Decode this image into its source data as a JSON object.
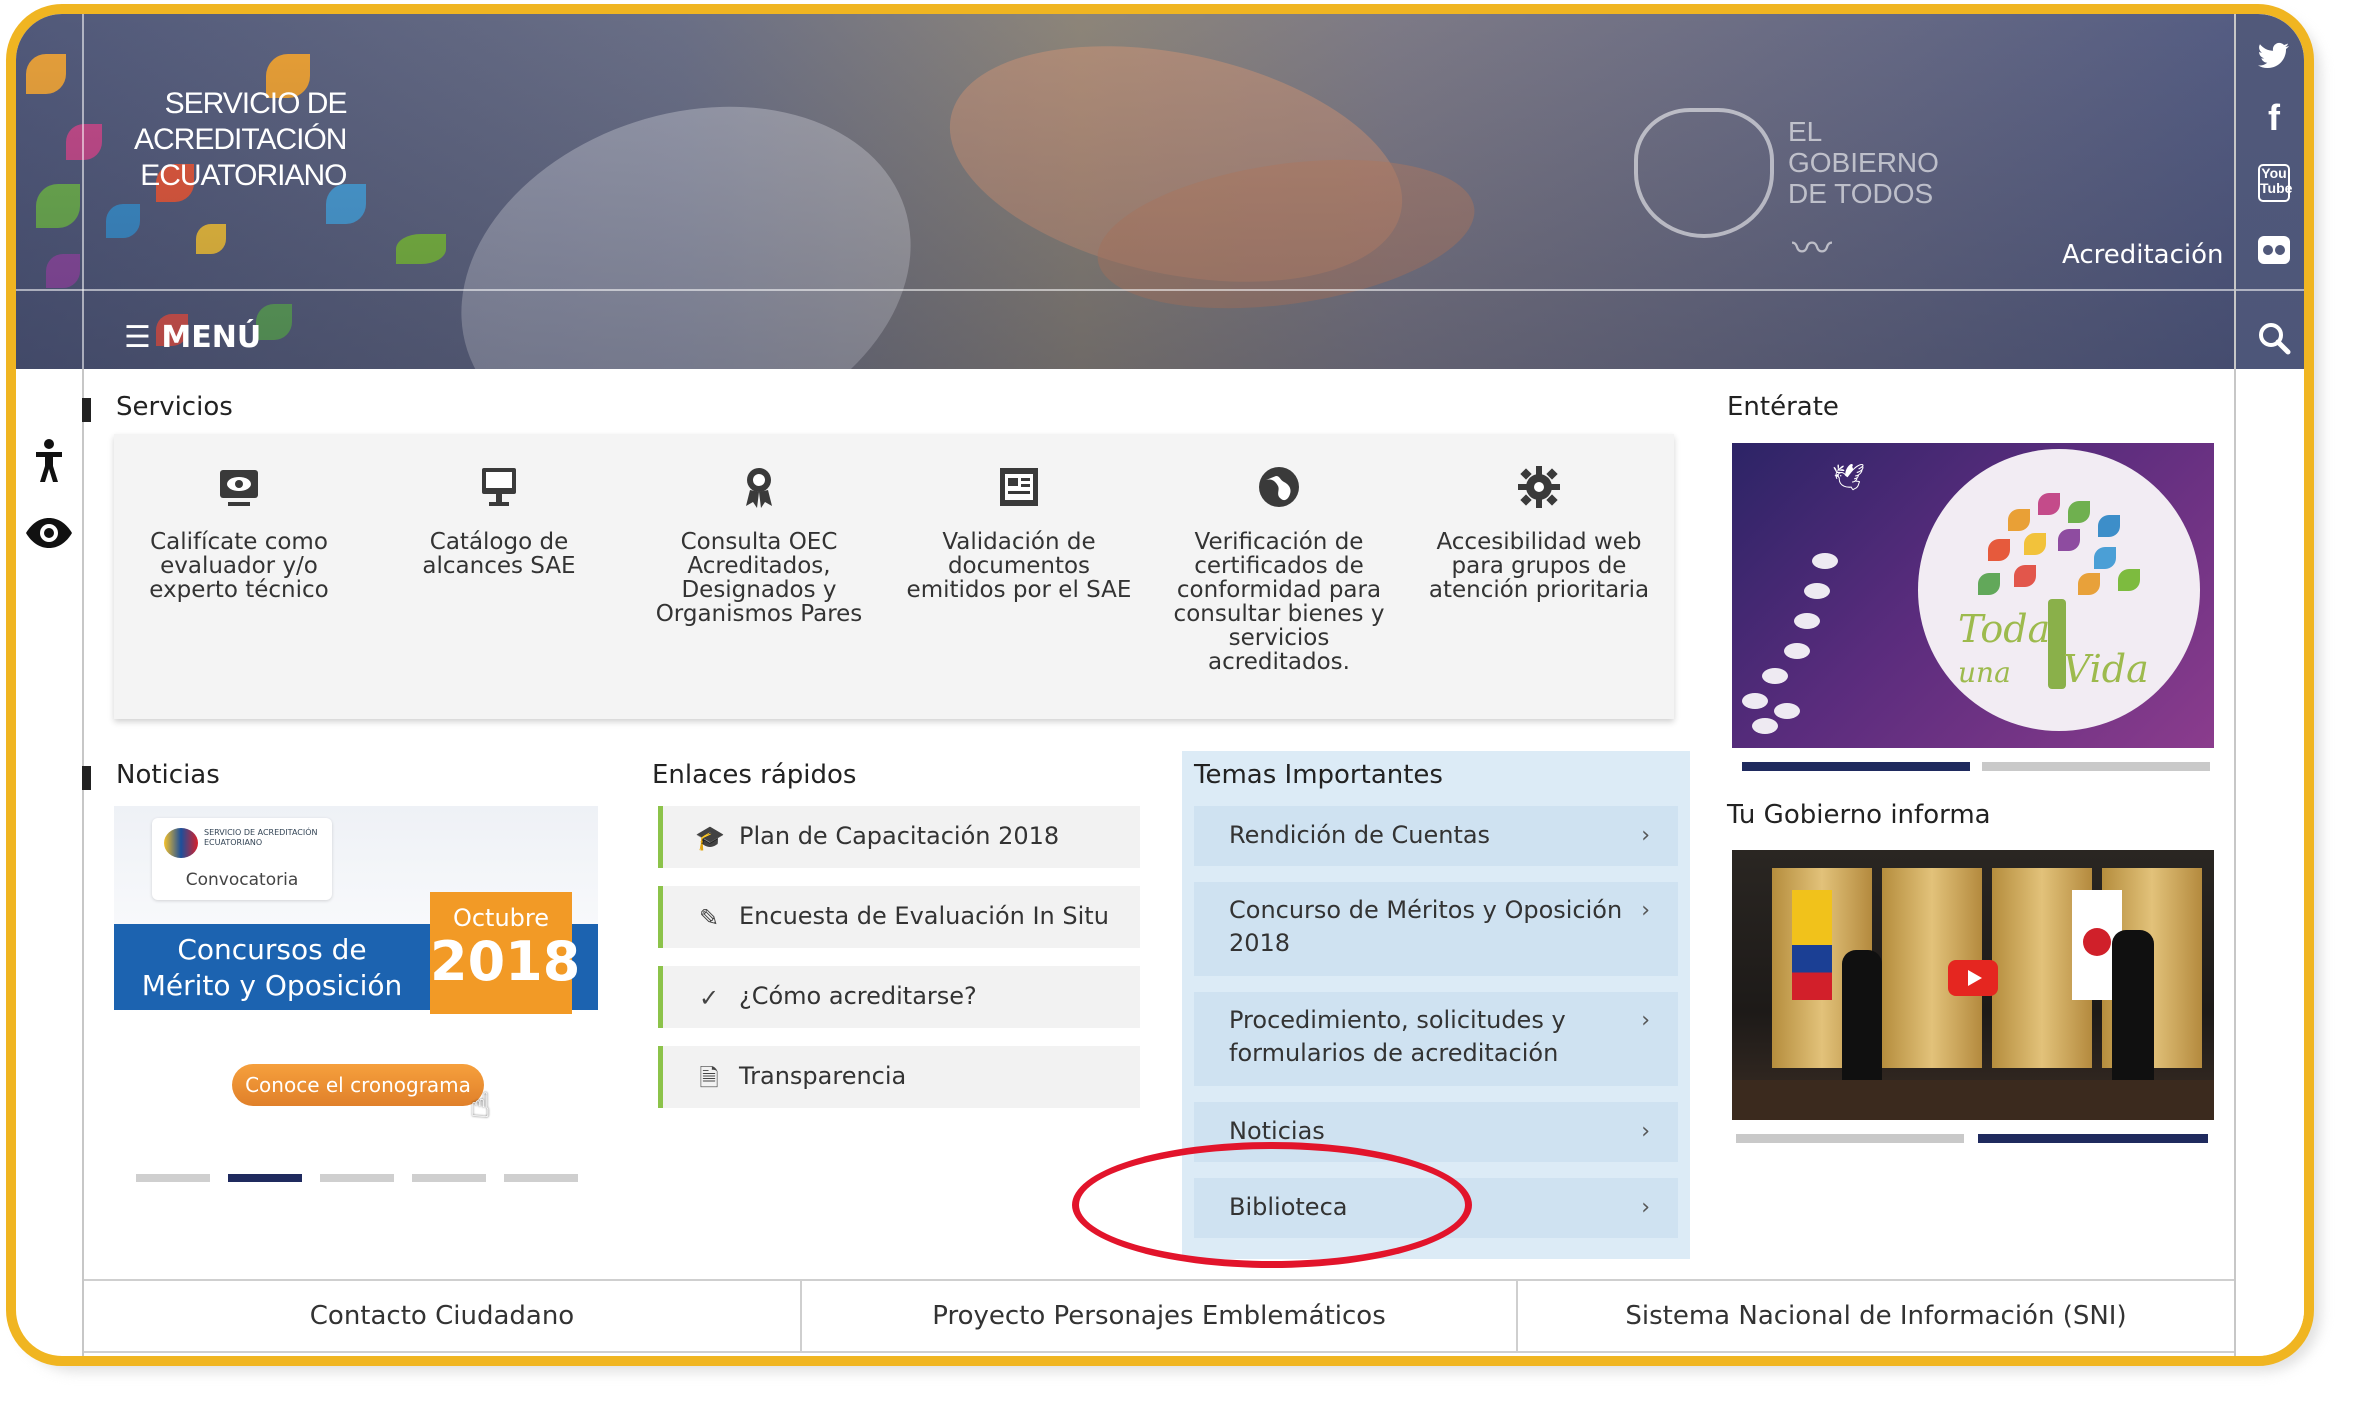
{
  "header": {
    "logo_lines": [
      "SERVICIO DE",
      "ACREDITACIÓN",
      "ECUATORIANO"
    ],
    "gobierno_lines": [
      "EL",
      "GOBIERNO",
      "DE TODOS"
    ],
    "section_label": "Acreditación",
    "menu_label": "MENÚ"
  },
  "social": {
    "icons": [
      "twitter-icon",
      "facebook-icon",
      "youtube-icon",
      "flickr-icon",
      "search-icon"
    ],
    "youtube_text": "You Tube"
  },
  "accessibility": {
    "icons": [
      "accessibility-person-icon",
      "eye-icon"
    ]
  },
  "servicios": {
    "title": "Servicios",
    "items": [
      {
        "icon": "eye-monitor-icon",
        "label": "Califícate como evaluador y/o experto técnico"
      },
      {
        "icon": "desktop-icon",
        "label": "Catálogo de alcances SAE"
      },
      {
        "icon": "award-icon",
        "label": "Consulta OEC Acreditados, Designados y Organismos Pares"
      },
      {
        "icon": "document-check-icon",
        "label": "Validación de documentos emitidos por el SAE"
      },
      {
        "icon": "globe-icon",
        "label": "Verificación de certificados de conformidad para consultar bienes y servicios acreditados."
      },
      {
        "icon": "gear-icon",
        "label": "Accesibilidad web para grupos de atención prioritaria"
      }
    ]
  },
  "noticias": {
    "title": "Noticias",
    "banner": {
      "card_small": "SERVICIO DE ACREDITACIÓN ECUATORIANO",
      "card_text": "Convocatoria",
      "headline_1": "Concursos de",
      "headline_2": "Mérito y Oposición",
      "month": "Octubre",
      "year": "2018",
      "cta": "Conoce el cronograma"
    },
    "carousel_count": 5,
    "carousel_active": 2
  },
  "enlaces": {
    "title": "Enlaces rápidos",
    "items": [
      {
        "icon": "graduation-cap-icon",
        "label": "Plan de Capacitación 2018"
      },
      {
        "icon": "edit-icon",
        "label": "Encuesta de Evaluación In Situ"
      },
      {
        "icon": "check-icon",
        "label": "¿Cómo acreditarse?"
      },
      {
        "icon": "file-icon",
        "label": "Transparencia"
      }
    ]
  },
  "temas": {
    "title": "Temas Importantes",
    "items": [
      {
        "label_1": "Rendición de Cuentas",
        "label_2": ""
      },
      {
        "label_1": "Concurso de Méritos y Oposición",
        "label_2": "2018"
      },
      {
        "label_1": "Procedimiento, solicitudes y",
        "label_2": "formularios de acreditación"
      },
      {
        "label_1": "Noticias",
        "label_2": ""
      },
      {
        "label_1": "Biblioteca",
        "label_2": ""
      }
    ],
    "chevron": "›"
  },
  "enterate": {
    "title": "Entérate",
    "banner_text_1": "Toda",
    "banner_text_2": "una",
    "banner_text_3": "Vida",
    "carousel_count": 2,
    "carousel_active": 1
  },
  "gobierno_informa": {
    "title": "Tu Gobierno informa",
    "carousel_count": 2,
    "carousel_active": 2
  },
  "footer": {
    "items": [
      "Contacto Ciudadano",
      "Proyecto Personajes Emblemáticos",
      "Sistema Nacional de Información (SNI)"
    ]
  },
  "colors": {
    "frame": "#f0b521",
    "header": "#51597a",
    "quicklink_accent": "#8cc34a",
    "temas_bg": "#dcebf6",
    "carousel_active": "#1f2a5e",
    "annotation": "#e2142b"
  }
}
